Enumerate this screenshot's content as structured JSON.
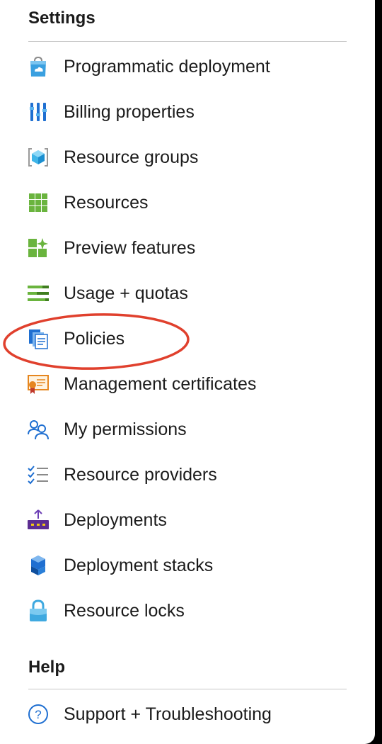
{
  "settings": {
    "title": "Settings",
    "items": [
      {
        "label": "Programmatic deployment",
        "icon": "shopping-bag-cloud-icon"
      },
      {
        "label": "Billing properties",
        "icon": "sliders-bars-icon"
      },
      {
        "label": "Resource groups",
        "icon": "resource-group-cube-icon"
      },
      {
        "label": "Resources",
        "icon": "grid-icon"
      },
      {
        "label": "Preview features",
        "icon": "preview-sparkle-icon"
      },
      {
        "label": "Usage + quotas",
        "icon": "usage-bars-icon"
      },
      {
        "label": "Policies",
        "icon": "policy-documents-icon"
      },
      {
        "label": "Management certificates",
        "icon": "certificate-icon"
      },
      {
        "label": "My permissions",
        "icon": "users-icon"
      },
      {
        "label": "Resource providers",
        "icon": "checklist-icon"
      },
      {
        "label": "Deployments",
        "icon": "deployment-upload-icon"
      },
      {
        "label": "Deployment stacks",
        "icon": "stacked-cubes-icon"
      },
      {
        "label": "Resource locks",
        "icon": "lock-icon"
      }
    ]
  },
  "help": {
    "title": "Help",
    "items": [
      {
        "label": "Support + Troubleshooting",
        "icon": "question-circle-icon"
      }
    ]
  },
  "annotation": {
    "highlighted_item": "Policies",
    "color": "#e0402d"
  }
}
